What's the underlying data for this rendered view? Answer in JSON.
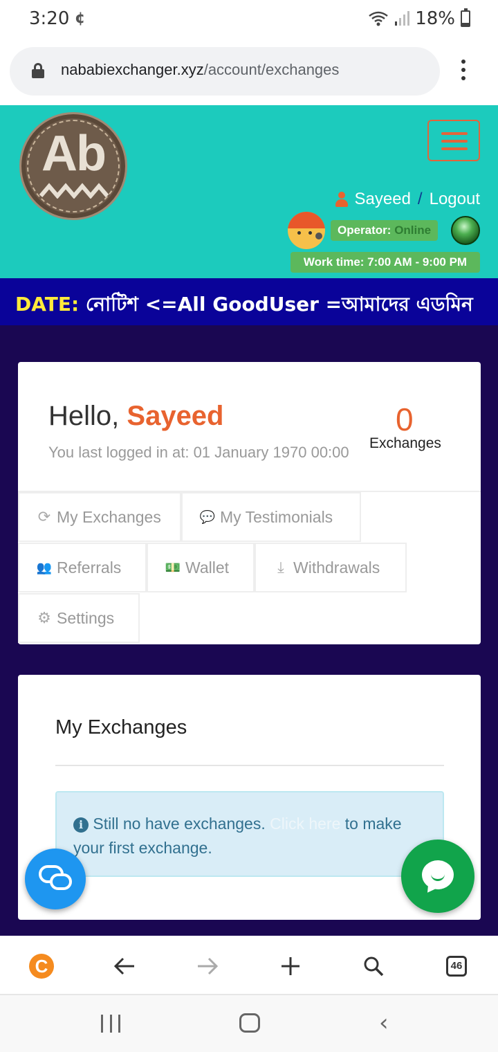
{
  "status_bar": {
    "time": "3:20",
    "notification_glyph": "¢",
    "battery": "18%"
  },
  "browser": {
    "url_domain": "nababiexchanger.xyz",
    "url_path": "/account/exchanges",
    "tabs_count": "46",
    "icons": [
      "lock-icon",
      "menu-kebab-icon",
      "coin-icon",
      "back-arrow-icon",
      "forward-arrow-icon",
      "new-tab-icon",
      "search-icon",
      "tabs-icon"
    ]
  },
  "header": {
    "logo_text": "Ab",
    "username": "Sayeed",
    "separator": "/",
    "logout": "Logout",
    "operator_label": "Operator:",
    "operator_status": "Online",
    "worktime": "Work time: 7:00 AM - 9:00 PM"
  },
  "marquee": {
    "date_label": "DATE:",
    "text": " নোটিশ <=All GoodUser =আমাদের এডমিন"
  },
  "dashboard": {
    "hello": "Hello, ",
    "name": "Sayeed",
    "last_login": "You last logged in at: 01 January 1970 00:00",
    "exchanges_count": "0",
    "exchanges_label": "Exchanges",
    "tabs": [
      {
        "icon": "⟳",
        "label": "My Exchanges"
      },
      {
        "icon": "💬",
        "label": "My Testimonials"
      },
      {
        "icon": "👥",
        "label": "Referrals"
      },
      {
        "icon": "💵",
        "label": "Wallet"
      },
      {
        "icon": "⤓",
        "label": "Withdrawals"
      },
      {
        "icon": "⚙",
        "label": "Settings"
      }
    ]
  },
  "exchanges_panel": {
    "title": "My Exchanges",
    "info_icon": "i",
    "message_before": " Still no have exchanges. ",
    "link_text": "Click here",
    "message_after": " to make your first exchange."
  },
  "colors": {
    "header_bg": "#1ccbbd",
    "accent_orange": "#e8632f",
    "marquee_bg": "#0a0399",
    "page_bg": "#1a0752",
    "online_green": "#5cb85c",
    "whatsapp_green": "#11a44b",
    "chat_blue": "#1e96f0"
  }
}
